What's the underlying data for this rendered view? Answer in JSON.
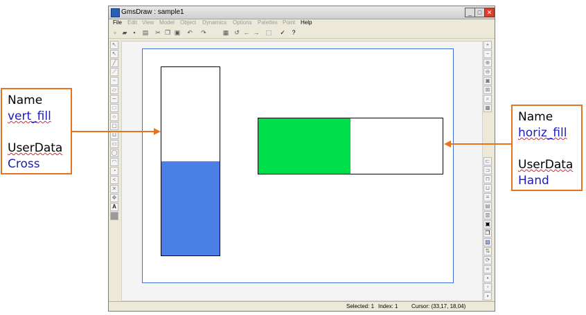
{
  "window": {
    "title": "GmsDraw : sample1",
    "minimize": "_",
    "maximize": "□",
    "close": "✕"
  },
  "menu": [
    {
      "label": "File",
      "enabled": true
    },
    {
      "label": "Edit",
      "enabled": false
    },
    {
      "label": "View",
      "enabled": false
    },
    {
      "label": "Model",
      "enabled": false
    },
    {
      "label": "Object",
      "enabled": false
    },
    {
      "label": "Dynamics",
      "enabled": false
    },
    {
      "label": "Options",
      "enabled": false
    },
    {
      "label": "Palettes",
      "enabled": false
    },
    {
      "label": "Point",
      "enabled": false
    },
    {
      "label": "Help",
      "enabled": true
    }
  ],
  "toolbar_icons": [
    "new-file-icon",
    "open-folder-icon",
    "save-icon",
    "print-icon",
    "cut-icon",
    "copy-icon",
    "paste-icon",
    "undo-icon",
    "redo-icon",
    "properties-icon",
    "refresh-icon",
    "back-arrow-icon",
    "forward-arrow-icon",
    "select-icon",
    "check-icon",
    "help-icon"
  ],
  "objects": {
    "vert_fill": {
      "fill_fraction": 0.5,
      "color": "#4a80e6"
    },
    "horiz_fill": {
      "fill_fraction": 0.5,
      "color": "#00dd4a"
    }
  },
  "status": {
    "selected": "Selected: 1",
    "index": "Index: 1",
    "cursor": "Cursor: (33,17, 18,04)"
  },
  "callouts": {
    "left": {
      "name_label": "Name",
      "name_value": "vert_fill",
      "userdata_label": "UserData",
      "userdata_value": "Cross"
    },
    "right": {
      "name_label": "Name",
      "name_value": "horiz_fill",
      "userdata_label": "UserData",
      "userdata_value": "Hand"
    }
  },
  "colors": {
    "accent": "#e7731e",
    "link": "#1a1abf",
    "page_border": "#3b6fd6"
  }
}
